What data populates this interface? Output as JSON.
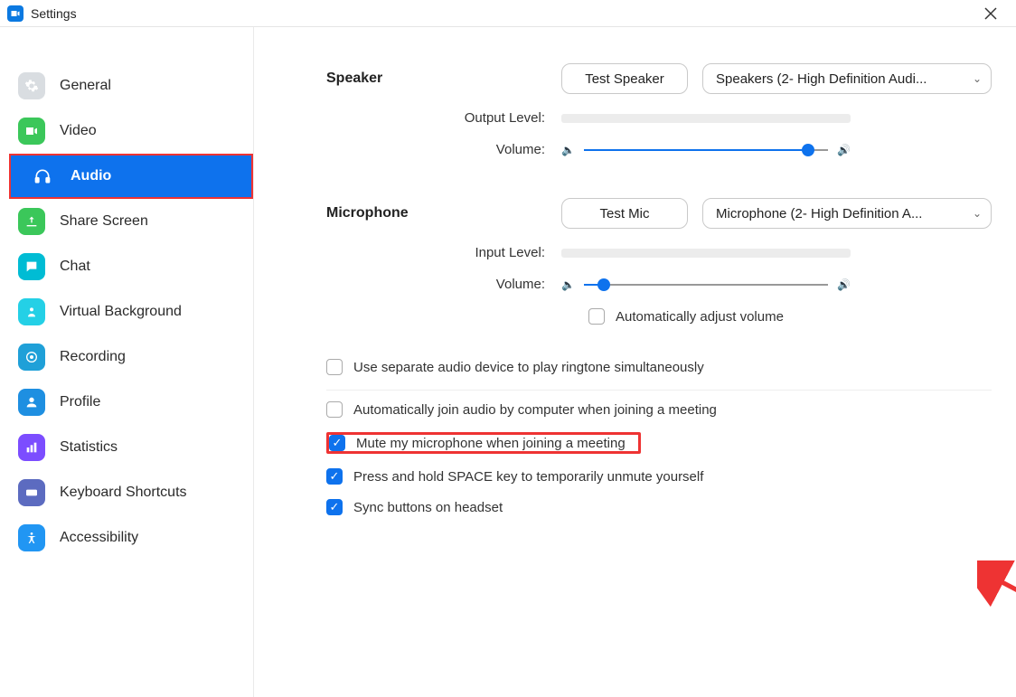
{
  "titlebar": {
    "title": "Settings"
  },
  "sidebar": {
    "items": [
      {
        "label": "General"
      },
      {
        "label": "Video"
      },
      {
        "label": "Audio"
      },
      {
        "label": "Share Screen"
      },
      {
        "label": "Chat"
      },
      {
        "label": "Virtual Background"
      },
      {
        "label": "Recording"
      },
      {
        "label": "Profile"
      },
      {
        "label": "Statistics"
      },
      {
        "label": "Keyboard Shortcuts"
      },
      {
        "label": "Accessibility"
      }
    ],
    "active_index": 2
  },
  "main": {
    "speaker": {
      "heading": "Speaker",
      "test_btn": "Test Speaker",
      "device": "Speakers (2- High Definition Audi...",
      "output_level_label": "Output Level:",
      "volume_label": "Volume:",
      "volume_percent": 92
    },
    "microphone": {
      "heading": "Microphone",
      "test_btn": "Test Mic",
      "device": "Microphone (2- High Definition A...",
      "input_level_label": "Input Level:",
      "volume_label": "Volume:",
      "volume_percent": 8,
      "auto_adjust_label": "Automatically adjust volume",
      "auto_adjust_checked": false
    },
    "options": {
      "separate_device": {
        "label": "Use separate audio device to play ringtone simultaneously",
        "checked": false
      },
      "auto_join": {
        "label": "Automatically join audio by computer when joining a meeting",
        "checked": false
      },
      "mute_on_join": {
        "label": "Mute my microphone when joining a meeting",
        "checked": true
      },
      "space_unmute": {
        "label": "Press and hold SPACE key to temporarily unmute yourself",
        "checked": true
      },
      "sync_headset": {
        "label": "Sync buttons on headset",
        "checked": true
      }
    }
  }
}
